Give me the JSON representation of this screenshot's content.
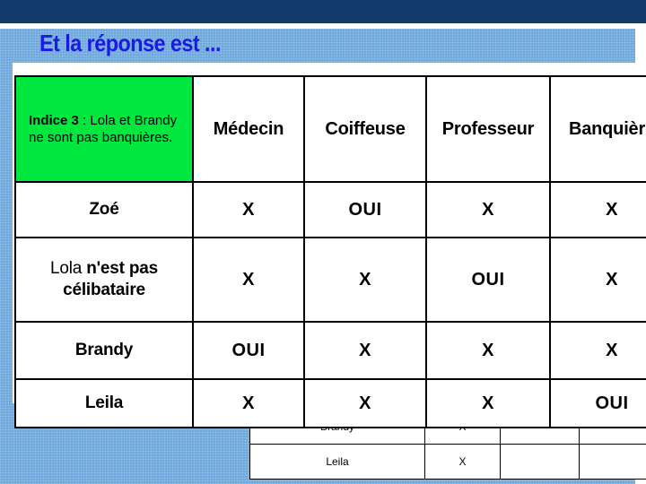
{
  "slide": {
    "title": "Et la réponse est ...",
    "title_color": "#1a1ae2",
    "band_color": "#123a6d",
    "background_color": "#6ea8dd",
    "clue_highlight_color": "#00e83e"
  },
  "grid": {
    "clue": {
      "label": "Indice 3",
      "separator": " : ",
      "text_line1": "Lola",
      "text_rest": "et Brandy ne sont pas banquières."
    },
    "columns": [
      "Médecin",
      "Coiffeuse",
      "Professeur",
      "Banquière"
    ],
    "rows": [
      {
        "name": "Zoé",
        "name_prefix": "",
        "values": [
          "X",
          "OUI",
          "X",
          "X"
        ]
      },
      {
        "name": "n'est pas célibataire",
        "name_prefix": "Lola ",
        "values": [
          "X",
          "X",
          "OUI",
          "X"
        ]
      },
      {
        "name": "Brandy",
        "name_prefix": "",
        "values": [
          "OUI",
          "X",
          "X",
          "X"
        ]
      },
      {
        "name": "Leila",
        "name_prefix": "",
        "values": [
          "X",
          "X",
          "X",
          "OUI"
        ]
      }
    ]
  },
  "background_table": {
    "rows": [
      {
        "name": "Brandy",
        "mark": "X",
        "empty1": "",
        "empty2": ""
      },
      {
        "name": "Leila",
        "mark": "X",
        "empty1": "",
        "empty2": ""
      }
    ]
  }
}
